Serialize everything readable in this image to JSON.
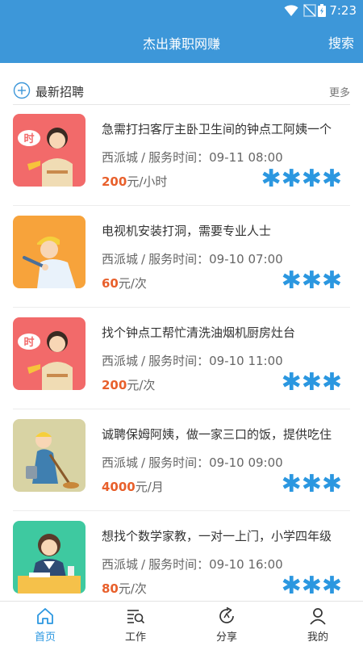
{
  "status_bar": {
    "time": "7:23",
    "icons": [
      "wifi-icon",
      "no-signal-icon",
      "battery-icon"
    ]
  },
  "app_bar": {
    "title": "杰出兼职网赚",
    "search_label": "搜索"
  },
  "section": {
    "title": "最新招聘",
    "more_label": "更多",
    "icon": "plus-circle-icon"
  },
  "jobs": [
    {
      "title": "急需打扫客厅主卧卫生间的钟点工阿姨一个",
      "location": "西派城",
      "service_label": "服务时间：",
      "time": "09-11 08:00",
      "price": "200",
      "unit": "元/小时",
      "rating_stars": "✱✱✱✱",
      "thumb_color": "#f26a6a",
      "thumb_icon": "housekeeper-illustration",
      "thumb_badge": "时"
    },
    {
      "title": "电视机安装打洞，需要专业人士",
      "location": "西派城",
      "service_label": "服务时间：",
      "time": "09-10 07:00",
      "price": "60",
      "unit": "元/次",
      "rating_stars": "✱✱✱",
      "thumb_color": "#f7a33b",
      "thumb_icon": "repair-worker-illustration",
      "thumb_badge": ""
    },
    {
      "title": "找个钟点工帮忙清洗油烟机厨房灶台",
      "location": "西派城",
      "service_label": "服务时间：",
      "time": "09-10 11:00",
      "price": "200",
      "unit": "元/次",
      "rating_stars": "✱✱✱",
      "thumb_color": "#f26a6a",
      "thumb_icon": "housekeeper-illustration",
      "thumb_badge": "时"
    },
    {
      "title": "诚聘保姆阿姨，做一家三口的饭，提供吃住",
      "location": "西派城",
      "service_label": "服务时间：",
      "time": "09-10 09:00",
      "price": "4000",
      "unit": "元/月",
      "rating_stars": "✱✱✱",
      "thumb_color": "#d8d3a4",
      "thumb_icon": "cleaner-illustration",
      "thumb_badge": ""
    },
    {
      "title": "想找个数学家教，一对一上门，小学四年级",
      "location": "西派城",
      "service_label": "服务时间：",
      "time": "09-10 16:00",
      "price": "80",
      "unit": "元/次",
      "rating_stars": "✱✱✱",
      "thumb_color": "#3ec9a0",
      "thumb_icon": "tutor-illustration",
      "thumb_badge": ""
    }
  ],
  "tabs": [
    {
      "label": "首页",
      "icon": "home-icon",
      "active": true
    },
    {
      "label": "工作",
      "icon": "work-search-icon",
      "active": false
    },
    {
      "label": "分享",
      "icon": "share-icon",
      "active": false
    },
    {
      "label": "我的",
      "icon": "person-icon",
      "active": false
    }
  ],
  "colors": {
    "primary": "#3d97d9",
    "price": "#e8602c",
    "rating": "#2b97e0",
    "tab_active": "#2b97e0"
  }
}
